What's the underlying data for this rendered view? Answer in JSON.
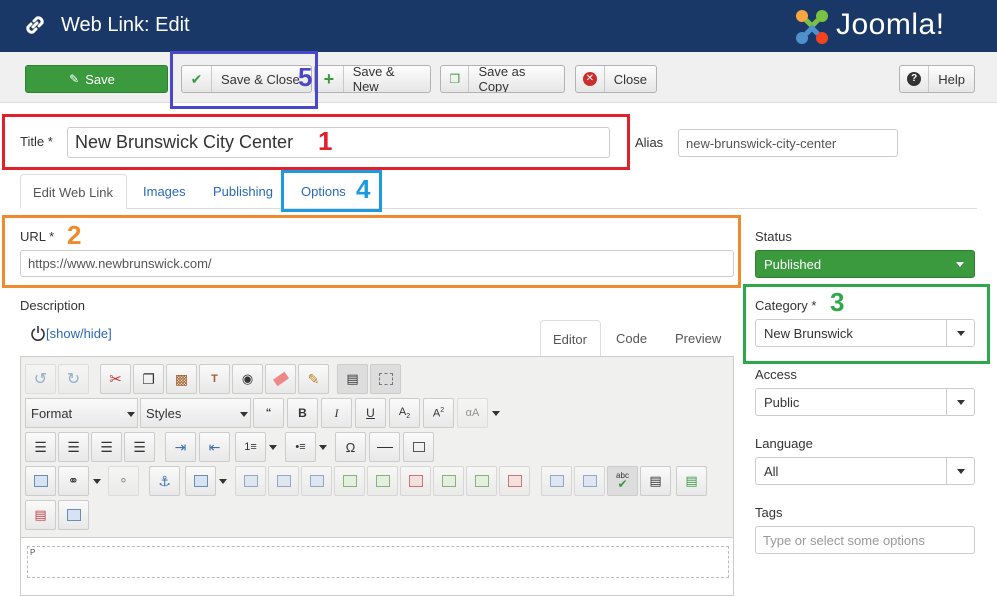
{
  "header": {
    "title": "Web Link: Edit",
    "brand": "Joomla!",
    "bg_color": "#1a3867"
  },
  "toolbar": {
    "save": "Save",
    "save_close": "Save & Close",
    "save_new": "Save & New",
    "save_copy": "Save as Copy",
    "close": "Close",
    "help": "Help"
  },
  "form": {
    "title_label": "Title *",
    "title_value": "New Brunswick City Center",
    "alias_label": "Alias",
    "alias_value": "new-brunswick-city-center",
    "url_label": "URL *",
    "url_value": "https://www.newbrunswick.com/",
    "description_label": "Description",
    "show_hide": "[show/hide]"
  },
  "tabs": [
    "Edit Web Link",
    "Images",
    "Publishing",
    "Options"
  ],
  "editor": {
    "tabs": [
      "Editor",
      "Code",
      "Preview"
    ],
    "format": "Format",
    "styles": "Styles",
    "path": "P"
  },
  "sidebar": {
    "status_label": "Status",
    "status_value": "Published",
    "category_label": "Category *",
    "category_value": "New Brunswick",
    "access_label": "Access",
    "access_value": "Public",
    "language_label": "Language",
    "language_value": "All",
    "tags_label": "Tags",
    "tags_placeholder": "Type or select some options"
  },
  "annotations": {
    "n1": "1",
    "n2": "2",
    "n3": "3",
    "n4": "4",
    "n5": "5",
    "c1": "#e0202a",
    "c2": "#f08a2c",
    "c3": "#2ea84a",
    "c4": "#1c9be0",
    "c5": "#4848c8"
  }
}
